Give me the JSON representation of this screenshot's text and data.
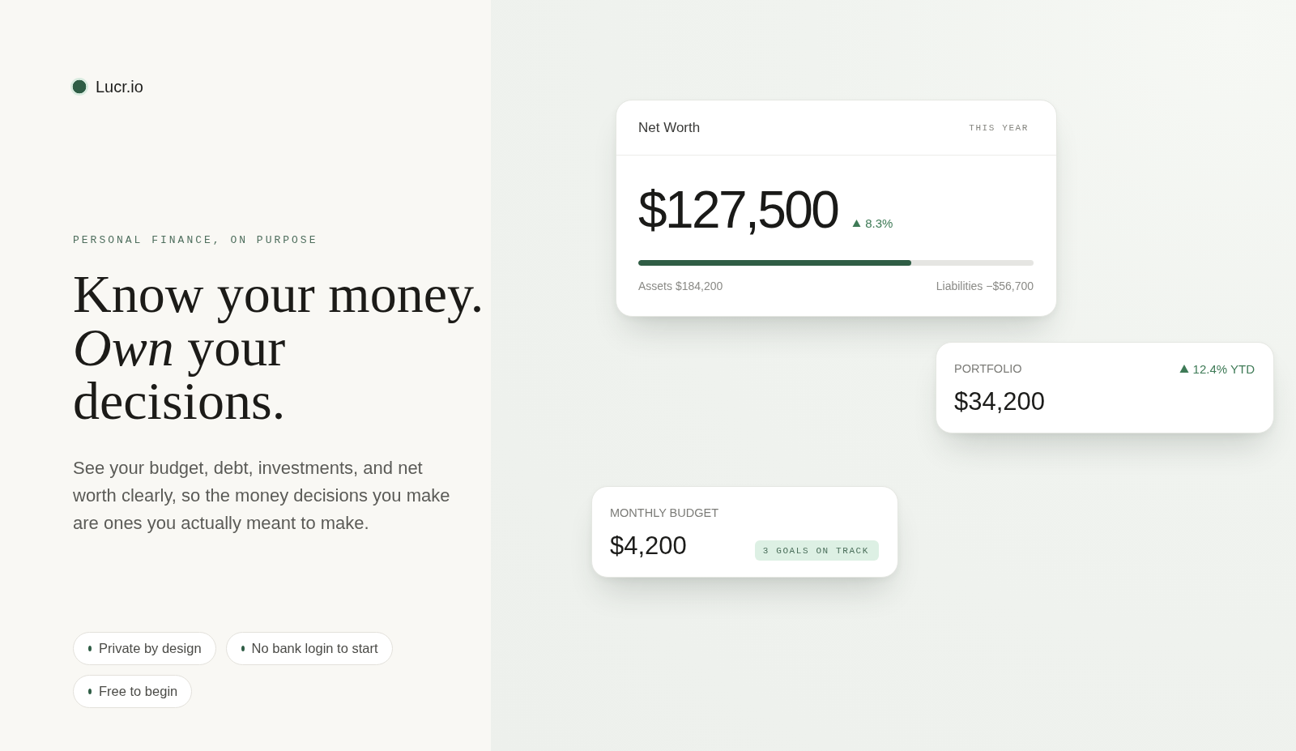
{
  "brand": {
    "name": "Lucr.io"
  },
  "hero": {
    "eyebrow": "PERSONAL FINANCE, ON PURPOSE",
    "headline": "Know your money. *Own* your decisions.",
    "description": "See your budget, debt, investments, and net worth clearly, so the money decisions you make are ones you actually meant to make.",
    "features": [
      "Private by design",
      "No bank login to start",
      "Free to begin"
    ]
  },
  "cards": [
    {
      "kind": "overview",
      "title": "Net Worth",
      "period": "THIS YEAR",
      "value": "$127,500",
      "rising": true,
      "change": "8.3%",
      "level": 0.69,
      "assets": "Assets $184,200",
      "liabilities": "Liabilities −$56,700"
    },
    {
      "kind": "trend",
      "label": "PORTFOLIO",
      "rising": true,
      "change": "12.4% YTD",
      "value": "$34,200"
    },
    {
      "kind": "goals",
      "label": "MONTHLY BUDGET",
      "value": "$4,200",
      "badge": "3 GOALS ON TRACK"
    }
  ]
}
